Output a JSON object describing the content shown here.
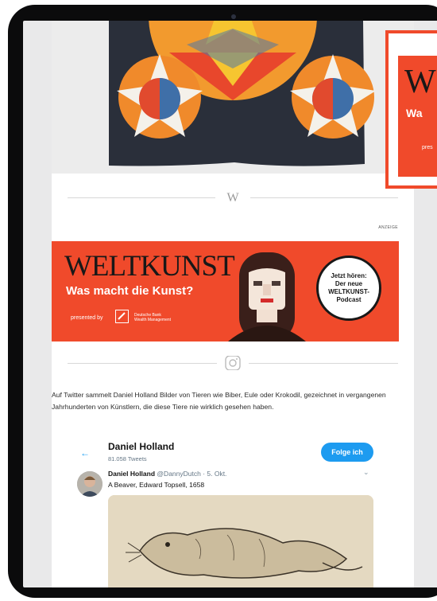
{
  "separator": {
    "wordmark": "W"
  },
  "ad": {
    "label": "ANZEIGE",
    "logo": "WELTKUNST",
    "slogan": "Was macht die Kunst?",
    "presented_by": "presented by",
    "sponsor_line1": "Deutsche Bank",
    "sponsor_line2": "Wealth Management",
    "badge_line1": "Jetzt hören:",
    "badge_line2": "Der neue",
    "badge_line3": "WELTKUNST-",
    "badge_line4": "Podcast",
    "color": "#f04a2b"
  },
  "intro_text": "Auf Twitter sammelt Daniel Holland Bilder von Tieren wie Biber, Eule oder Krokodil, gezeichnet in vergangenen Jahrhunderten von Künstlern, die diese Tiere nie wirklich gesehen haben.",
  "tweet": {
    "header_name": "Daniel Holland",
    "tweet_count": "81.058 Tweets",
    "follow_label": "Folge ich",
    "author_name": "Daniel Holland",
    "handle": "@DannyDutch",
    "date": " · 5. Okt.",
    "text": "A Beaver, Edward Topsell, 1658",
    "accent": "#1d9bf0"
  },
  "popup": {
    "logo": "W",
    "slogan": "Wa",
    "presented": "pres"
  },
  "icons": [
    "instagram-icon",
    "back-arrow-icon",
    "chevron-down-icon",
    "deutsche-bank-logo-icon"
  ]
}
